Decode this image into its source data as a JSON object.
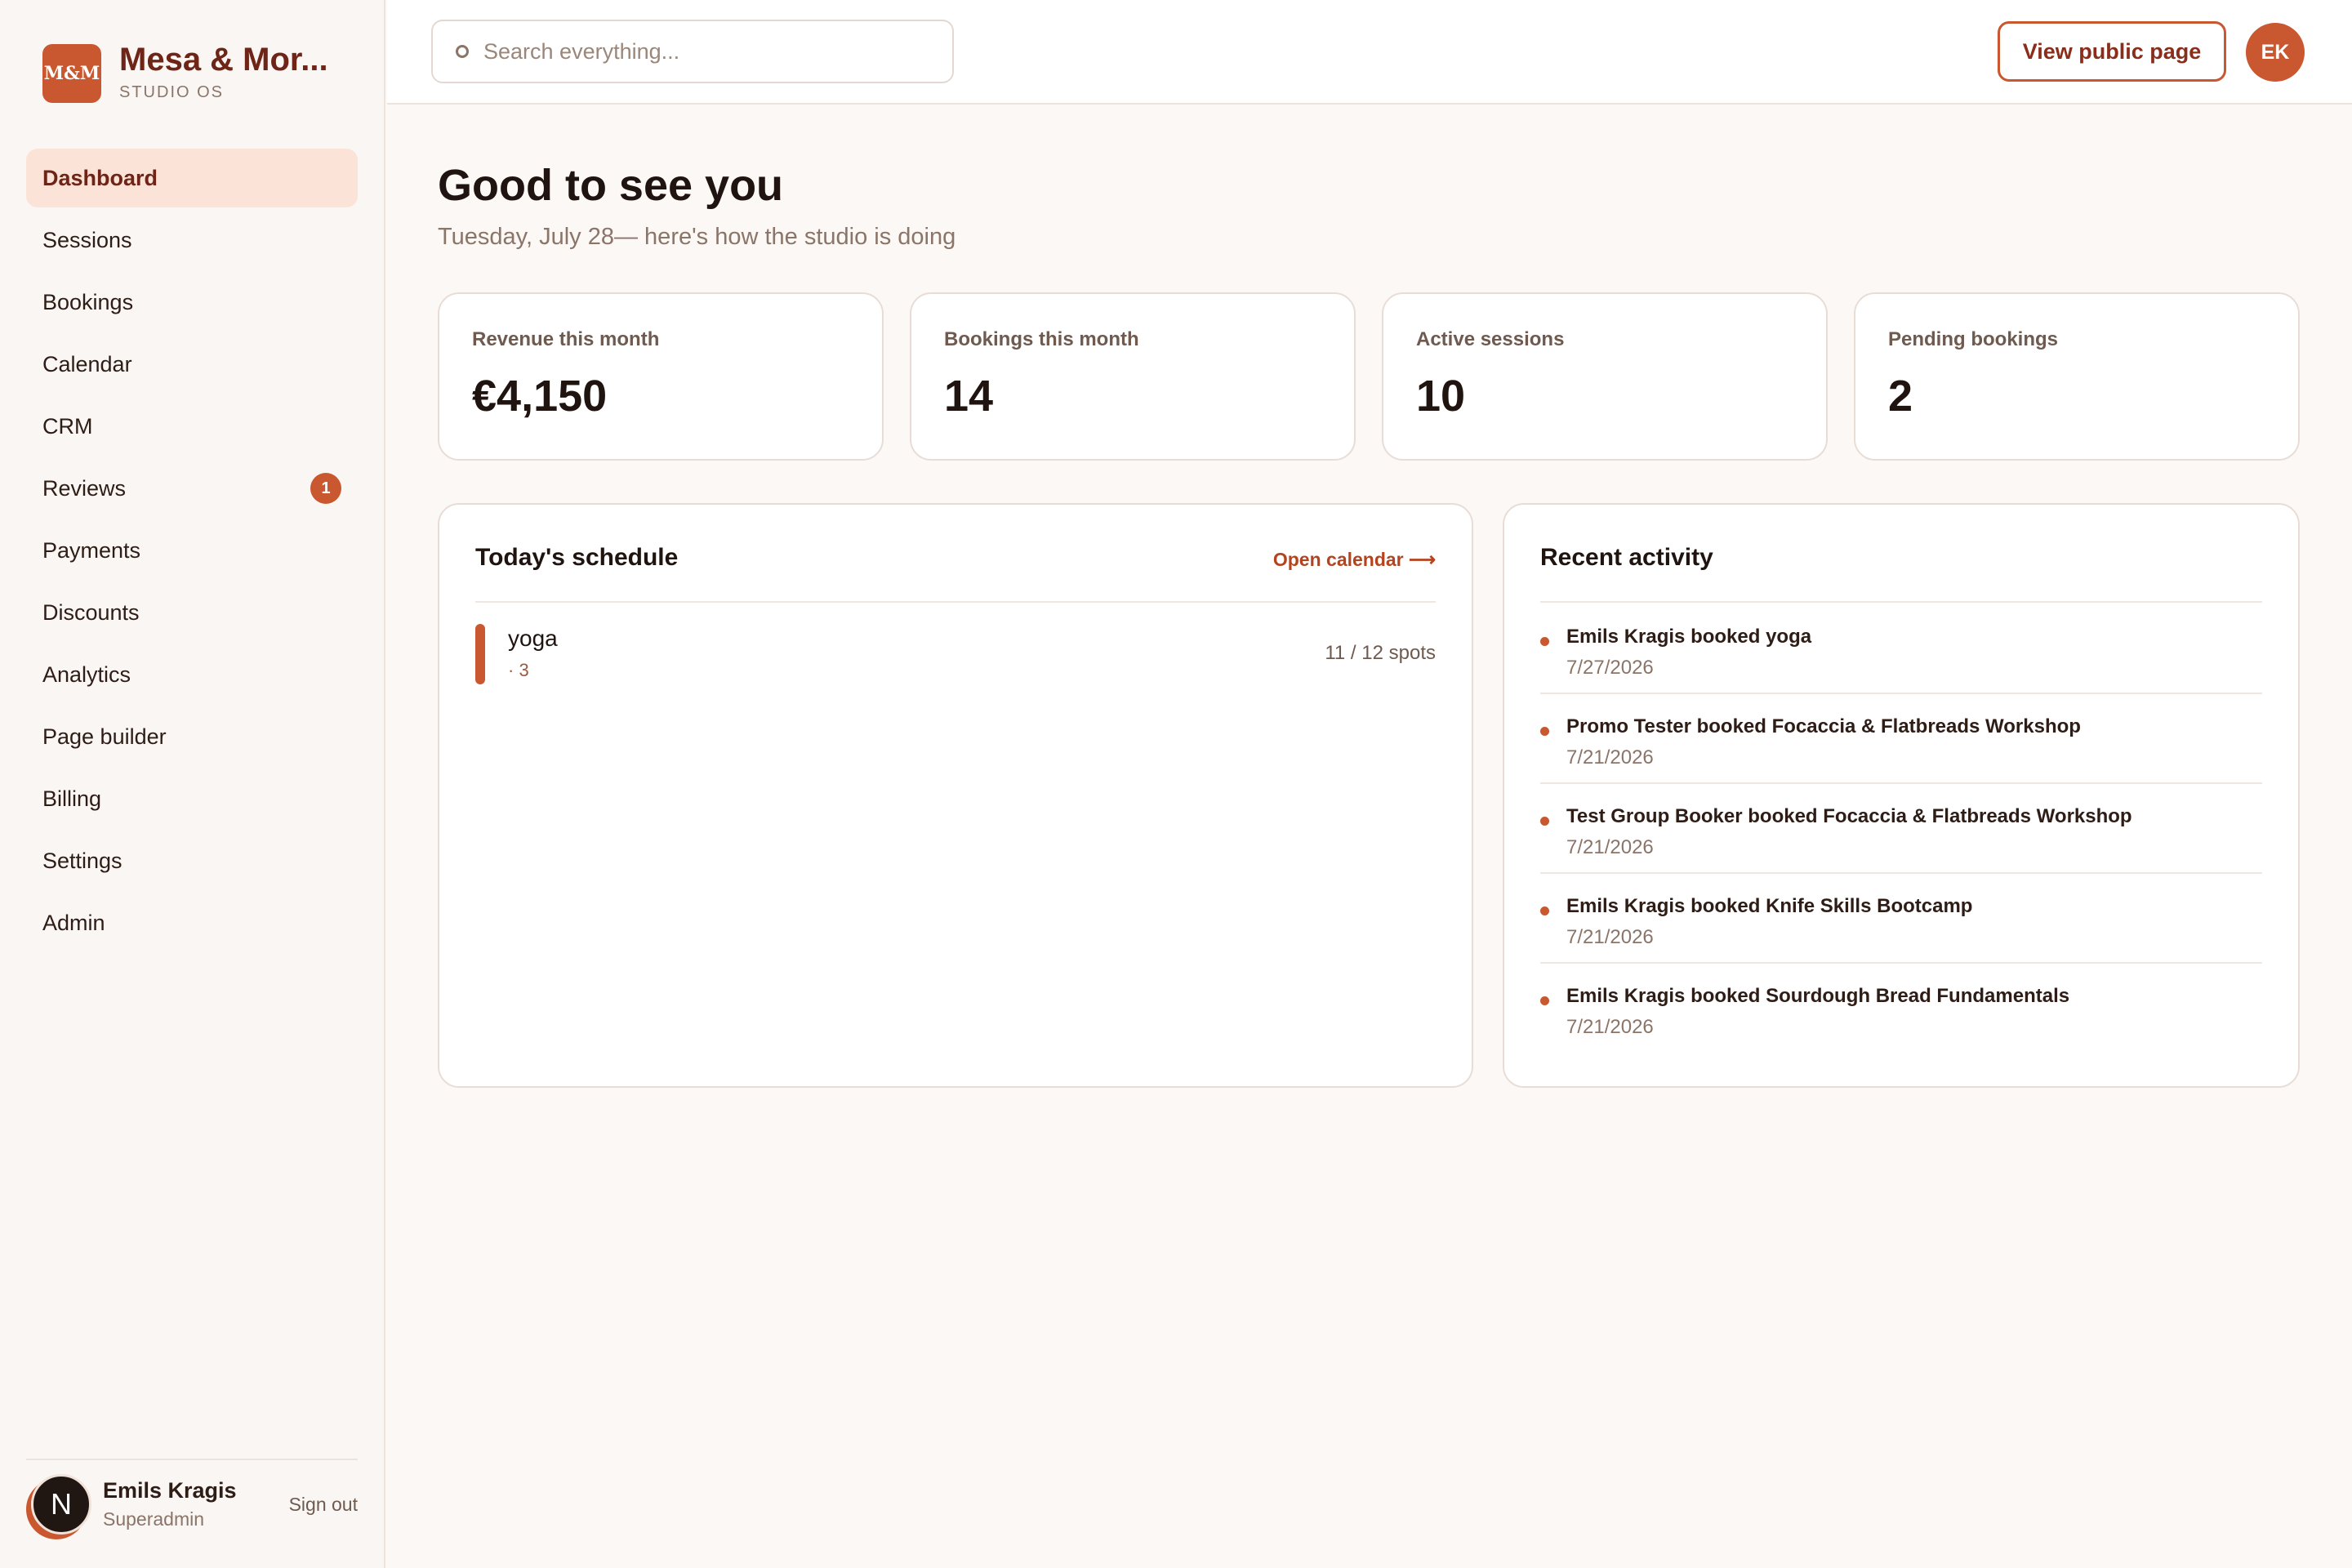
{
  "brand": {
    "logo_text": "M&M",
    "name": "Mesa & Mor...",
    "subtitle": "STUDIO OS",
    "accent_color": "#c9572f"
  },
  "sidebar": {
    "items": [
      {
        "label": "Dashboard",
        "active": true
      },
      {
        "label": "Sessions"
      },
      {
        "label": "Bookings"
      },
      {
        "label": "Calendar"
      },
      {
        "label": "CRM"
      },
      {
        "label": "Reviews",
        "badge": "1"
      },
      {
        "label": "Payments"
      },
      {
        "label": "Discounts"
      },
      {
        "label": "Analytics"
      },
      {
        "label": "Page builder"
      },
      {
        "label": "Billing"
      },
      {
        "label": "Settings"
      },
      {
        "label": "Admin"
      }
    ],
    "user": {
      "avatar_letter": "N",
      "name": "Emils Kragis",
      "role": "Superadmin",
      "sign_out": "Sign out"
    }
  },
  "topbar": {
    "search_placeholder": "Search everything...",
    "view_public_label": "View public page",
    "avatar_initials": "EK"
  },
  "main": {
    "greeting": "Good to see you",
    "subgreeting": "Tuesday, July 28— here's how the studio is doing",
    "stats": [
      {
        "label": "Revenue this month",
        "value": "€4,150"
      },
      {
        "label": "Bookings this month",
        "value": "14"
      },
      {
        "label": "Active sessions",
        "value": "10"
      },
      {
        "label": "Pending bookings",
        "value": "2"
      }
    ],
    "schedule": {
      "title": "Today's schedule",
      "link": "Open calendar ⟶",
      "items": [
        {
          "name": "yoga",
          "meta": "· 3",
          "spots": "11 / 12 spots"
        }
      ]
    },
    "activity": {
      "title": "Recent activity",
      "items": [
        {
          "text": "Emils Kragis booked yoga",
          "date": "7/27/2026"
        },
        {
          "text": "Promo Tester booked Focaccia & Flatbreads Workshop",
          "date": "7/21/2026"
        },
        {
          "text": "Test Group Booker booked Focaccia & Flatbreads Workshop",
          "date": "7/21/2026"
        },
        {
          "text": "Emils Kragis booked Knife Skills Bootcamp",
          "date": "7/21/2026"
        },
        {
          "text": "Emils Kragis booked Sourdough Bread Fundamentals",
          "date": "7/21/2026"
        }
      ]
    }
  }
}
